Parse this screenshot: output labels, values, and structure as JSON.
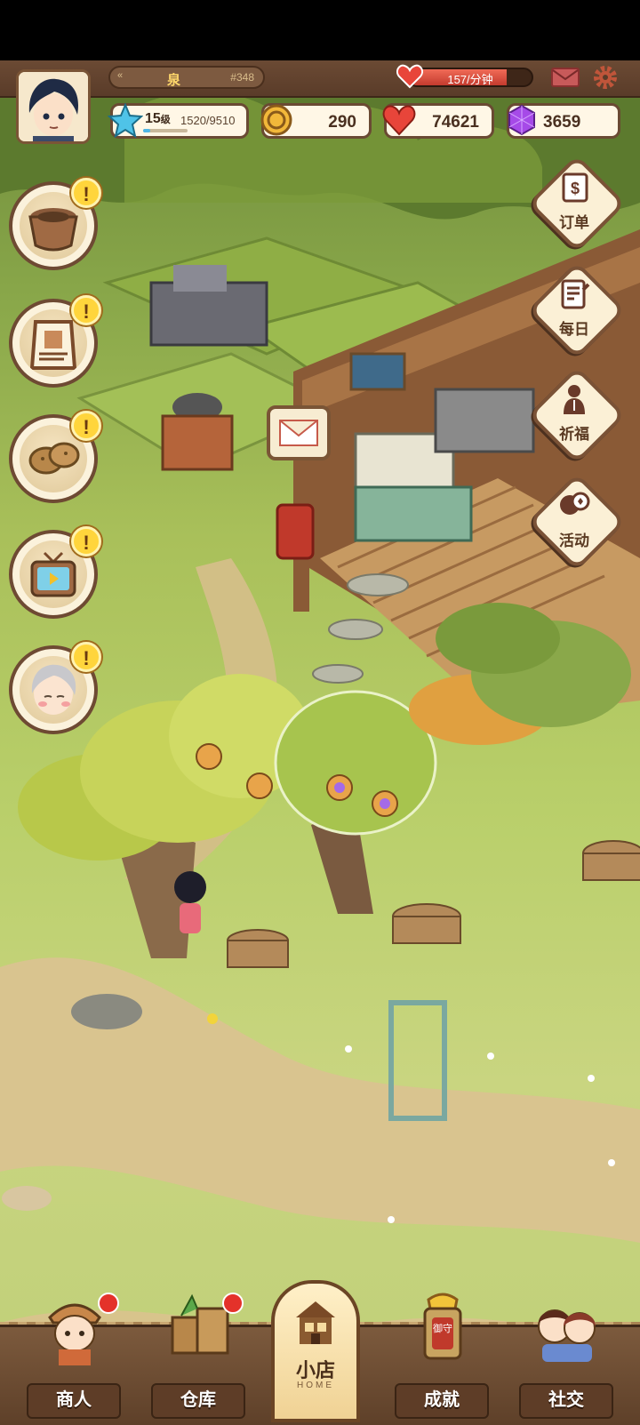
{
  "player": {
    "name": "泉",
    "id": "#348",
    "level": "15",
    "level_unit": "级",
    "xp": "1520/9510",
    "xp_fraction": 0.16
  },
  "production_rate": {
    "text": "157/分钟",
    "fill_fraction": 0.8
  },
  "resources": {
    "coins": "290",
    "hearts": "74621",
    "gems": "3659"
  },
  "left_buttons": [
    {
      "icon": "clay-pot-icon",
      "alert": "!"
    },
    {
      "icon": "shop-sign-icon",
      "alert": "!"
    },
    {
      "icon": "potato-icon",
      "alert": "!"
    },
    {
      "icon": "tv-video-icon",
      "alert": "!"
    },
    {
      "icon": "grandpa-npc-icon",
      "alert": "!"
    }
  ],
  "right_menu": [
    {
      "icon": "order-book-icon",
      "label": "订单"
    },
    {
      "icon": "daily-note-icon",
      "label": "每日"
    },
    {
      "icon": "pray-icon",
      "label": "祈福"
    },
    {
      "icon": "event-balloon-icon",
      "label": "活动"
    }
  ],
  "bottom_nav": {
    "merchant": "商人",
    "warehouse": "仓库",
    "home": "小店",
    "home_sub": "HOME",
    "achievements": "成就",
    "achievements_badge": "御守",
    "social": "社交"
  },
  "colors": {
    "brown_frame": "#6e4a33",
    "alert_yellow": "#ffd53c",
    "notify_red": "#e4322a",
    "grass": "#a9c05a"
  }
}
